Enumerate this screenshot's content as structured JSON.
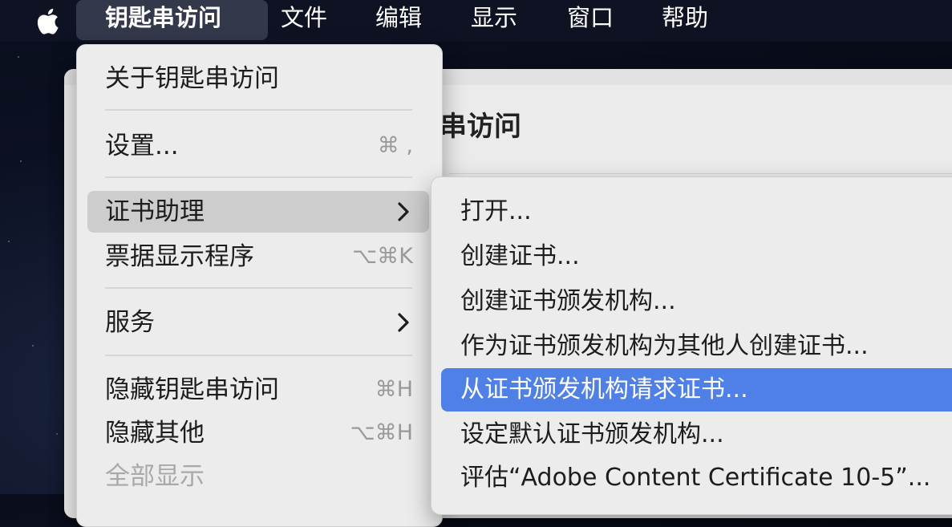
{
  "menubar": {
    "apple_icon": "apple-logo-icon",
    "items": [
      "钥匙串访问",
      "文件",
      "编辑",
      "显示",
      "窗口",
      "帮助"
    ],
    "active_index": 0
  },
  "background_window": {
    "title": "串访问"
  },
  "main_menu": {
    "items": [
      {
        "label": "关于钥匙串访问",
        "shortcut": ""
      },
      {
        "label": "设置...",
        "shortcut": "⌘ ,"
      },
      {
        "label": "证书助理",
        "shortcut": "",
        "submenu": true,
        "highlighted": true
      },
      {
        "label": "票据显示程序",
        "shortcut": "⌥⌘K"
      },
      {
        "label": "服务",
        "shortcut": "",
        "submenu": true
      },
      {
        "label": "隐藏钥匙串访问",
        "shortcut": "⌘H"
      },
      {
        "label": "隐藏其他",
        "shortcut": "⌥⌘H"
      },
      {
        "label": "全部显示",
        "shortcut": "",
        "disabled": true
      }
    ]
  },
  "submenu": {
    "items": [
      "打开...",
      "创建证书...",
      "创建证书颁发机构...",
      "作为证书颁发机构为其他人创建证书...",
      "从证书颁发机构请求证书...",
      "设定默认证书颁发机构...",
      "评估“Adobe Content Certificate 10-5”..."
    ],
    "selected_index": 4
  },
  "colors": {
    "selection": "#4f80e8",
    "menu_bg": "#ececec",
    "highlight": "#cdcdcd",
    "menubar_bg": "#0e1222"
  }
}
